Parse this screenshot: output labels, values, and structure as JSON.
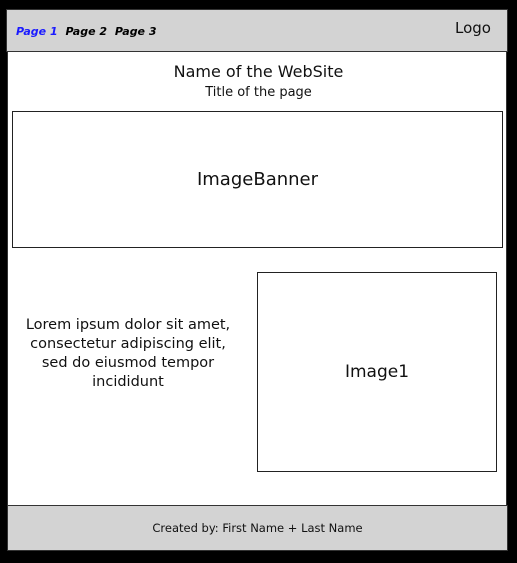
{
  "header": {
    "nav": [
      "Page 1",
      "Page 2",
      "Page 3"
    ],
    "logo": "Logo"
  },
  "site_name": "Name of the WebSite",
  "page_title": "Title of the page",
  "banner_label": "ImageBanner",
  "body_text": "Lorem ipsum dolor sit amet, consectetur adipiscing elit, sed do eiusmod tempor incididunt",
  "image_label": "Image1",
  "footer": "Created by: First Name + Last Name",
  "colors": {
    "active_nav": "#1a1aff",
    "header_bg": "#d3d3d3"
  }
}
